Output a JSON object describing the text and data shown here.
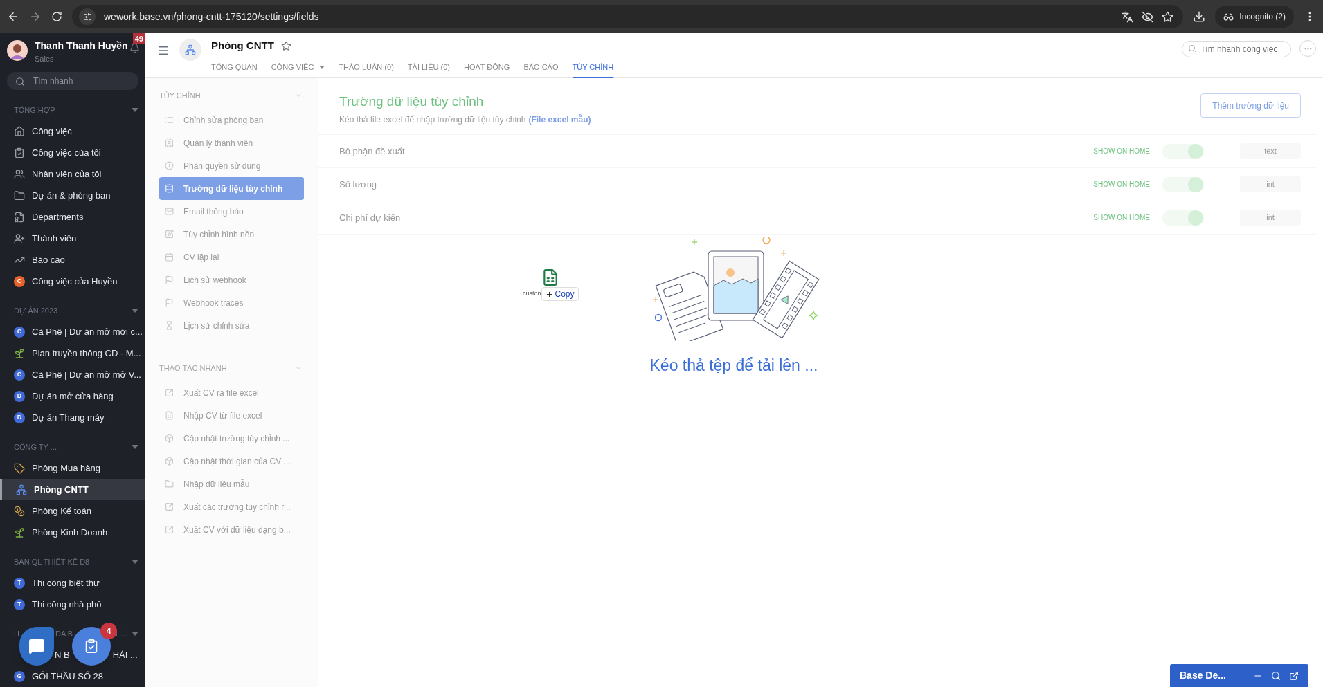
{
  "browser": {
    "url": "wework.base.vn/phong-cntt-175120/settings/fields",
    "profile": "Incognito (2)"
  },
  "sidebar": {
    "user": {
      "name": "Thanh Thanh Huyền",
      "role": "Sales"
    },
    "notifications": "49",
    "search": {
      "placeholder": "Tìm nhanh"
    },
    "sections": [
      {
        "title": "TỔNG HỢP",
        "items": [
          {
            "kind": "home",
            "label": "Công việc",
            "selected": false
          },
          {
            "kind": "clipboard",
            "label": "Công việc của tôi",
            "selected": false
          },
          {
            "kind": "people",
            "label": "Nhân viên của tôi",
            "selected": false
          },
          {
            "kind": "folder",
            "label": "Dự án & phòng ban",
            "selected": false
          },
          {
            "kind": "badge",
            "label": "Departments",
            "selected": false
          },
          {
            "kind": "members",
            "label": "Thành viên",
            "selected": false
          },
          {
            "kind": "chart",
            "label": "Báo cáo",
            "selected": false
          },
          {
            "kind": "letter",
            "letter": "C",
            "color": "#e8622c",
            "label": "Công việc của Huyền",
            "selected": false
          }
        ]
      },
      {
        "title": "DỰ ÁN 2023",
        "items": [
          {
            "kind": "letter",
            "letter": "C",
            "color": "#3f6ad8",
            "label": "Cà Phê | Dự án mở mới c...",
            "selected": false
          },
          {
            "kind": "plant",
            "label": "Plan truyền thông CD - M...",
            "selected": false
          },
          {
            "kind": "letter",
            "letter": "C",
            "color": "#3f6ad8",
            "label": "Cà Phê | Dự án mở mở V...",
            "selected": false
          },
          {
            "kind": "letter",
            "letter": "D",
            "color": "#3f6ad8",
            "label": "Dự án mở cửa hàng",
            "selected": false
          },
          {
            "kind": "letter",
            "letter": "D",
            "color": "#3f6ad8",
            "label": "Dự án Thang máy",
            "selected": false
          }
        ]
      },
      {
        "title": "CÔNG TY ...",
        "items": [
          {
            "kind": "tag",
            "label": "Phòng Mua hàng",
            "selected": false
          },
          {
            "kind": "org",
            "label": "Phòng CNTT",
            "selected": true
          },
          {
            "kind": "coins",
            "label": "Phòng Kế toán",
            "selected": false
          },
          {
            "kind": "plant",
            "label": "Phòng Kinh Doanh",
            "selected": false
          }
        ]
      },
      {
        "title": "BAN QL THIẾT KẾ D8",
        "items": [
          {
            "kind": "letter",
            "letter": "T",
            "color": "#3f6ad8",
            "label": "Thi công biệt thự",
            "selected": false
          },
          {
            "kind": "letter",
            "letter": "T",
            "color": "#3f6ad8",
            "label": "Thi công nhà phố",
            "selected": false
          }
        ]
      },
      {
        "title_parts": [
          "H",
          "DA B",
          "H..."
        ],
        "items": [
          {
            "kind": "covered",
            "label_parts": [
              "N B",
              "HẢI ..."
            ]
          },
          {
            "kind": "letter",
            "letter": "G",
            "color": "#3f6ad8",
            "label": "GÓI THẦU SỐ 28",
            "selected": false
          }
        ]
      }
    ]
  },
  "floating": {
    "tasks_badge": "4"
  },
  "header": {
    "title": "Phòng CNTT",
    "tabs": [
      {
        "label": "TỔNG QUAN",
        "selected": false,
        "has_menu": false
      },
      {
        "label": "CÔNG VIỆC",
        "selected": false,
        "has_menu": true
      },
      {
        "label": "THẢO LUẬN (0)",
        "selected": false,
        "has_menu": false
      },
      {
        "label": "TÀI LIỆU (0)",
        "selected": false,
        "has_menu": false
      },
      {
        "label": "HOẠT ĐỘNG",
        "selected": false,
        "has_menu": false
      },
      {
        "label": "BÁO CÁO",
        "selected": false,
        "has_menu": false
      },
      {
        "label": "TÙY CHỈNH",
        "selected": true,
        "has_menu": false
      }
    ],
    "search": {
      "placeholder": "Tìm nhanh công việc"
    }
  },
  "settings_menu": {
    "sections": [
      {
        "title": "TÙY CHỈNH",
        "items": [
          {
            "kind": "list",
            "label": "Chỉnh sửa phòng ban",
            "selected": false
          },
          {
            "kind": "contact",
            "label": "Quản lý thành viên",
            "selected": false
          },
          {
            "kind": "info",
            "label": "Phân quyền sử dụng",
            "selected": false
          },
          {
            "kind": "database",
            "label": "Trường dữ liệu tùy chỉnh",
            "selected": true
          },
          {
            "kind": "mail",
            "label": "Email thông báo",
            "selected": false
          },
          {
            "kind": "edit",
            "label": "Tùy chỉnh hình nền",
            "selected": false
          },
          {
            "kind": "calendar",
            "label": "CV lặp lại",
            "selected": false
          },
          {
            "kind": "flag",
            "label": "Lịch sử webhook",
            "selected": false
          },
          {
            "kind": "flag",
            "label": "Webhook traces",
            "selected": false
          },
          {
            "kind": "hourglass",
            "label": "Lịch sử chỉnh sửa",
            "selected": false
          }
        ]
      },
      {
        "title": "THAO TÁC NHANH",
        "items": [
          {
            "kind": "export",
            "label": "Xuất CV ra file excel",
            "selected": false
          },
          {
            "kind": "excel",
            "label": "Nhập CV từ file excel",
            "selected": false
          },
          {
            "kind": "box",
            "label": "Cập nhật trường tùy chỉnh ...",
            "selected": false
          },
          {
            "kind": "box",
            "label": "Cập nhật thời gian của CV ...",
            "selected": false
          },
          {
            "kind": "folder",
            "label": "Nhập dữ liệu mẫu",
            "selected": false
          },
          {
            "kind": "export",
            "label": "Xuất các trường tùy chỉnh r...",
            "selected": false
          },
          {
            "kind": "export",
            "label": "Xuất CV với dữ liệu dạng b...",
            "selected": false
          }
        ]
      }
    ]
  },
  "fields_page": {
    "title": "Trường dữ liệu tùy chỉnh",
    "subtitle": "Kéo thả file excel để nhập trường dữ liệu tùy chỉnh",
    "sample_link": "(File excel mẫu)",
    "add_button": "Thêm trường dữ liệu",
    "fields": [
      {
        "name": "Bộ phận đề xuất",
        "show_label": "SHOW ON HOME",
        "on": true,
        "type": "text"
      },
      {
        "name": "Số lượng",
        "show_label": "SHOW ON HOME",
        "on": true,
        "type": "int"
      },
      {
        "name": "Chi phí dự kiến",
        "show_label": "SHOW ON HOME",
        "on": true,
        "type": "int"
      }
    ]
  },
  "drop_zone": {
    "message": "Kéo thả tệp để tải lên ...",
    "drag_file_name": "custon",
    "drag_action": "Copy"
  },
  "chat_widget": {
    "title": "Base De..."
  }
}
